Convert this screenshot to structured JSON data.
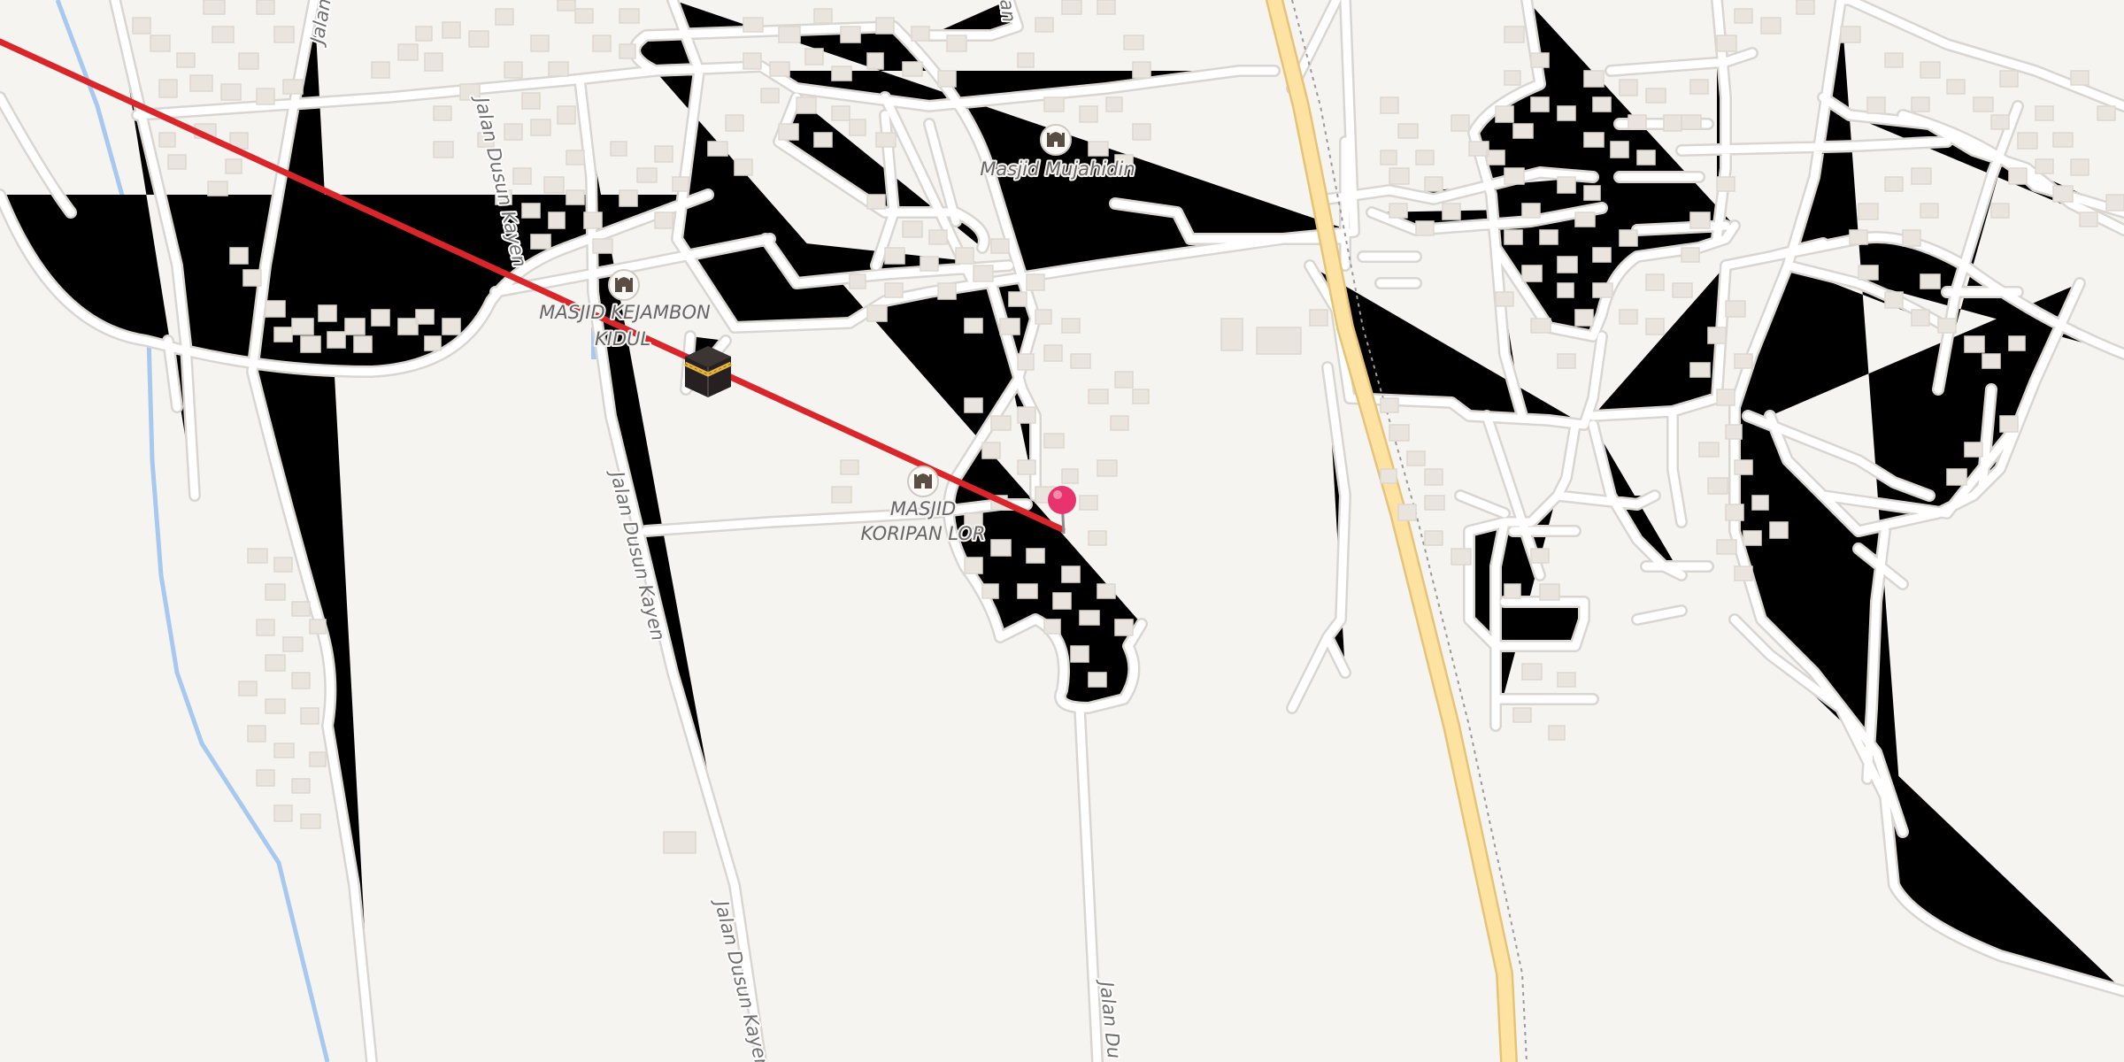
{
  "map": {
    "roads": {
      "jalan_dusun_kayen_north": "Jalan Dusun Kayen",
      "jalan_dusun_kayen_mid": "Jalan Dusun Kayen",
      "jalan_dusun_kayen_south": "Jalan Dusun Kayen",
      "jalan_top_left": "Jalan",
      "jalan_top_center": "an",
      "jalan_bottom_right": "Jalan Du"
    },
    "places": [
      {
        "name_line1": "Masjid Mujahidin",
        "name_line2": "",
        "icon": "mosque-icon"
      },
      {
        "name_line1": "MASJID KEJAMBON",
        "name_line2": "KIDUL",
        "icon": "mosque-icon"
      },
      {
        "name_line1": "MASJID",
        "name_line2": "KORIPAN LOR",
        "icon": "mosque-icon"
      }
    ],
    "markers": {
      "kaaba": "kaaba-icon",
      "location_pin": "location-pin-icon"
    },
    "colors": {
      "background": "#f6f4f1",
      "road": "#ffffff",
      "road_casing": "#d9d6d2",
      "primary_road": "#fde2a2",
      "river": "#a7c8ef",
      "qibla_line": "#d8262a",
      "pin": "#e8336f",
      "building": "#e9e4dd"
    }
  }
}
